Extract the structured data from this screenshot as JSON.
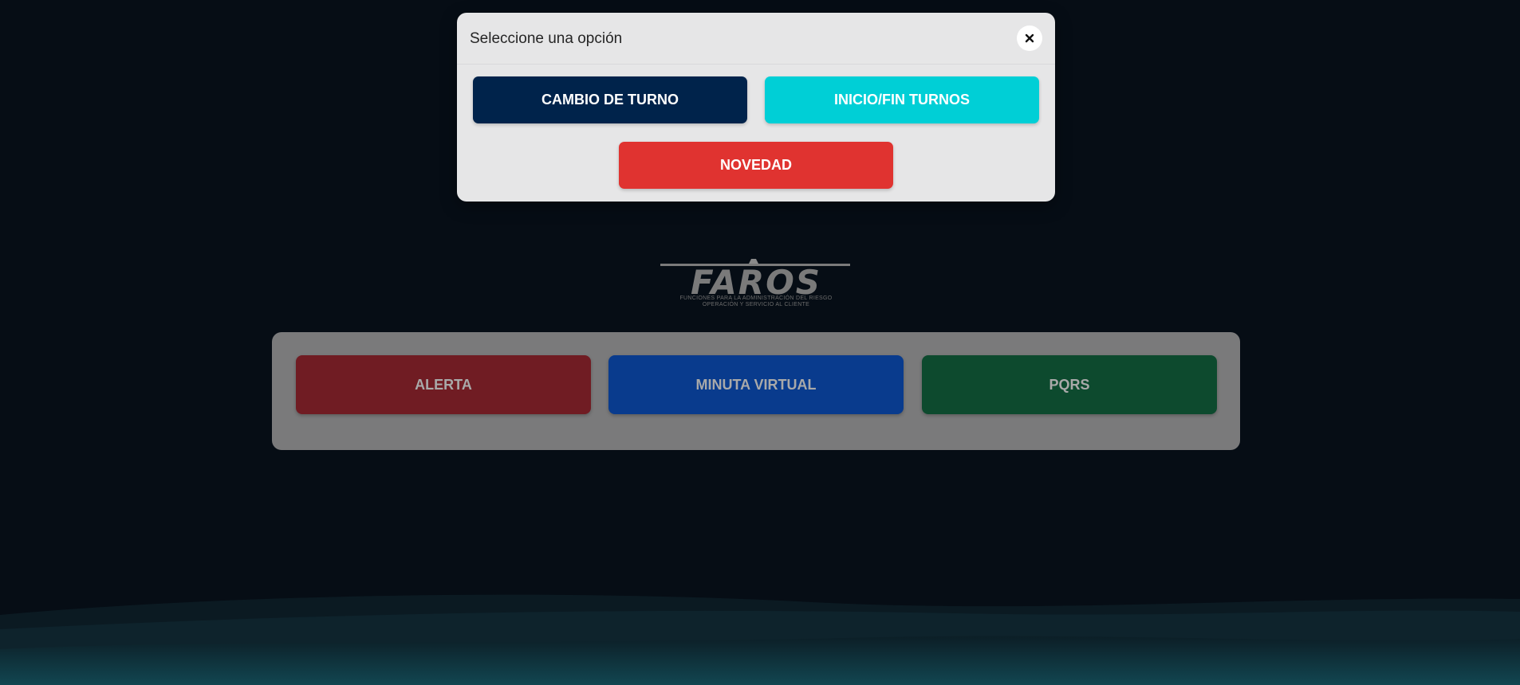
{
  "modal": {
    "title": "Seleccione una opción",
    "close_icon": "close-icon",
    "buttons": {
      "cambio_turno": "CAMBIO DE TURNO",
      "inicio_fin_turnos": "INICIO/FIN TURNOS",
      "novedad": "NOVEDAD"
    },
    "colors": {
      "cambio_turno": "#00234b",
      "inicio_fin_turnos": "#00cfd6",
      "novedad": "#e03330"
    }
  },
  "logo": {
    "name": "FAROS",
    "tagline_line1": "FUNCIONES PARA LA ADMINISTRACIÓN DEL RIESGO",
    "tagline_line2": "OPERACIÓN Y SERVICIO AL CLIENTE"
  },
  "main": {
    "buttons": {
      "alerta": "ALERTA",
      "minuta_virtual": "MINUTA VIRTUAL",
      "pqrs": "PQRS"
    },
    "colors": {
      "alerta": "#701c23",
      "minuta_virtual": "#093b8d",
      "pqrs": "#0d4a2e"
    }
  },
  "colors": {
    "background": "#060d15",
    "wave": "#0f2a33"
  }
}
